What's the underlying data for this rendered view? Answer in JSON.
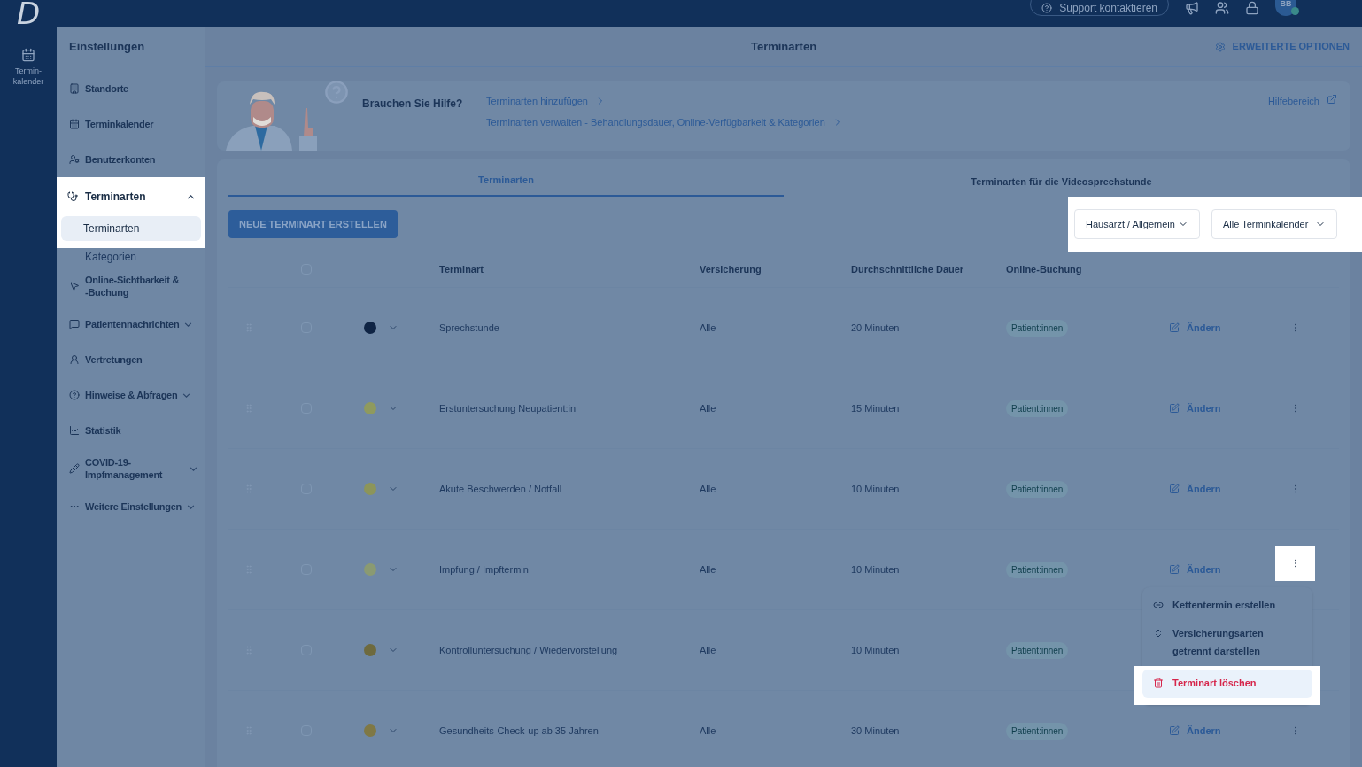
{
  "app": {
    "logo": "D",
    "rail_items": [
      {
        "label": "Termin-kalender"
      }
    ]
  },
  "top_bar": {
    "support": "Support kontaktieren",
    "avatar": "BB"
  },
  "sidebar": {
    "title": "Einstellungen",
    "items": [
      {
        "label": "Standorte"
      },
      {
        "label": "Terminkalender"
      },
      {
        "label": "Benutzerkonten"
      },
      {
        "label": "Terminarten",
        "expanded": true,
        "spotlight": true,
        "children": [
          {
            "label": "Terminarten",
            "selected": true,
            "spotlight": true
          },
          {
            "label": "Kategorien",
            "selected": false,
            "spotlight": false
          }
        ]
      },
      {
        "label": "Online-Sichtbarkeit & -Buchung"
      },
      {
        "label": "Patientennachrichten",
        "expanded": false
      },
      {
        "label": "Vertretungen"
      },
      {
        "label": "Hinweise & Abfragen",
        "expanded": false
      },
      {
        "label": "Statistik"
      },
      {
        "label": "COVID-19-Impfmanagement",
        "expanded": false
      },
      {
        "label": "Weitere Einstellungen",
        "expanded": false
      }
    ]
  },
  "header": {
    "title": "Terminarten",
    "options": "ERWEITERTE OPTIONEN"
  },
  "help": {
    "title": "Brauchen Sie Hilfe?",
    "links": [
      "Terminarten hinzufügen",
      "Terminarten verwalten - Behandlungsdauer, Online-Verfügbarkeit & Kategorien"
    ],
    "help_center": "Hilfebereich"
  },
  "tabs": [
    {
      "label": "Terminarten",
      "selected": true
    },
    {
      "label": "Terminarten für die Videosprechstunde",
      "selected": false
    }
  ],
  "create_button": "NEUE TERMINART ERSTELLEN",
  "filters": {
    "spotlight": true,
    "items": [
      "Hausarzt / Allgemein",
      "Alle Terminkalender"
    ]
  },
  "table": {
    "select_all_checked": false,
    "columns": [
      "Terminart",
      "Versicherung",
      "Durchschnittliche Dauer",
      "Online-Buchung"
    ],
    "rows": [
      {
        "name": "Sprechstunde",
        "insurance": "Alle",
        "duration": "20 Minuten",
        "booking": "Patient:innen",
        "color": "#0f2444",
        "checked": false,
        "edit": "Ändern",
        "menu_open": false
      },
      {
        "name": "Erstuntersuchung Neupatient:in",
        "insurance": "Alle",
        "duration": "15 Minuten",
        "booking": "Patient:innen",
        "color": "#8f9a5e",
        "checked": false,
        "edit": "Ändern",
        "menu_open": false
      },
      {
        "name": "Akute Beschwerden / Notfall",
        "insurance": "Alle",
        "duration": "10 Minuten",
        "booking": "Patient:innen",
        "color": "#8c955a",
        "checked": false,
        "edit": "Ändern",
        "menu_open": false
      },
      {
        "name": "Impfung / Impftermin",
        "insurance": "Alle",
        "duration": "10 Minuten",
        "booking": "Patient:innen",
        "color": "#8a9a72",
        "checked": false,
        "edit": "Ändern",
        "menu_open": true
      },
      {
        "name": "Kontrolluntersuchung / Wiedervorstellung",
        "insurance": "Alle",
        "duration": "10 Minuten",
        "booking": "Patient:innen",
        "color": "#6e6a3e",
        "checked": false,
        "menu_open": false
      },
      {
        "name": "Gesundheits-Check-up ab 35 Jahren",
        "insurance": "Alle",
        "duration": "30 Minuten",
        "booking": "Patient:innen",
        "color": "#7f7845",
        "checked": false,
        "edit": "Ändern",
        "menu_open": false
      }
    ]
  },
  "row_menu": {
    "items": [
      {
        "label": "Kettentermin erstellen",
        "kind": "action",
        "spotlight": false
      },
      {
        "label": "Versicherungsarten getrennt darstellen",
        "kind": "action",
        "spotlight": false
      },
      {
        "label": "Terminart löschen",
        "kind": "danger",
        "spotlight": true
      }
    ]
  }
}
